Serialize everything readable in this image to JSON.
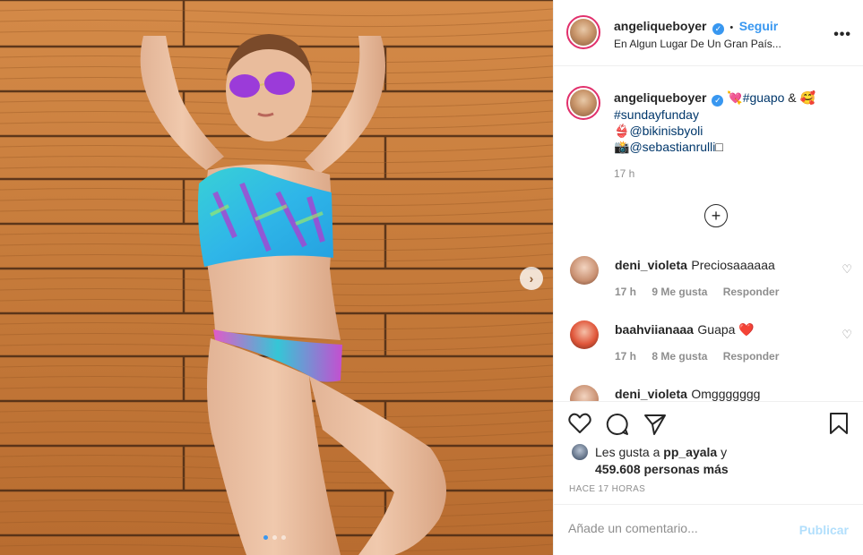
{
  "post": {
    "username": "angeliqueboyer",
    "follow_label": "Seguir",
    "separator": "•",
    "location": "En Algun Lugar De Un Gran País...",
    "more_label": "•••"
  },
  "caption": {
    "username": "angeliqueboyer",
    "emoji_heart": "💘",
    "tag_guapo": "#guapo",
    "amp": "&",
    "emoji_smile": "🥰",
    "tag_sunday": "#sundayfunday",
    "emoji_bikini": "👙",
    "mention_bikinis": "@bikinisbyoli",
    "emoji_camera": "📸",
    "mention_sebastian": "@sebastianrulli",
    "trailing_box": "□",
    "time": "17 h"
  },
  "load_more_symbol": "+",
  "comments": [
    {
      "user": "deni_violeta",
      "text": "Preciosaaaaaa",
      "time": "17 h",
      "likes": "9 Me gusta",
      "reply": "Responder"
    },
    {
      "user": "baahviianaaa",
      "text": "Guapa ❤️",
      "time": "17 h",
      "likes": "8 Me gusta",
      "reply": "Responder"
    },
    {
      "user": "deni_violeta",
      "text": "Omggggggg"
    }
  ],
  "likes_line": {
    "prefix": "Les gusta a",
    "user": "pp_ayala",
    "y": "y",
    "count": "459.608 personas más"
  },
  "time_ago": "HACE 17 HORAS",
  "add_comment": {
    "placeholder": "Añade un comentario...",
    "publish_label": "Publicar"
  },
  "icons": {
    "like": "heart-icon",
    "comment": "comment-icon",
    "share": "paper-plane-icon",
    "save": "bookmark-icon",
    "next": "chevron-right-icon"
  },
  "colors": {
    "accent": "#3897f0",
    "publish_disabled": "#b2dffc",
    "text": "#262626",
    "muted": "#8e8e8e"
  },
  "carousel": {
    "count": 3,
    "active_index": 0
  }
}
